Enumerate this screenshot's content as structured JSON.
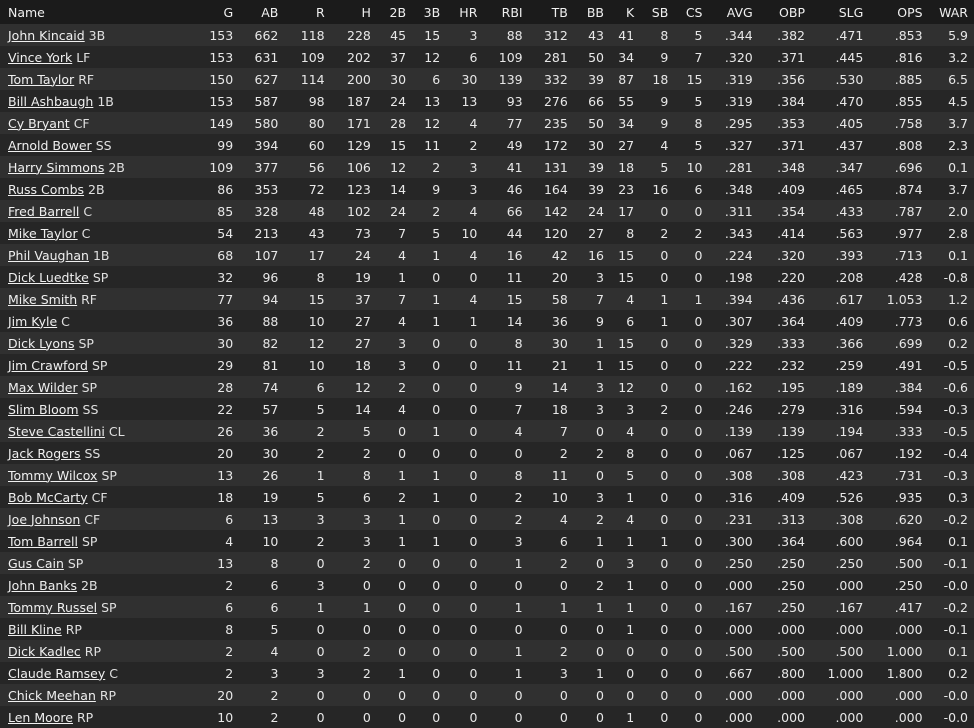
{
  "columns": [
    "Name",
    "G",
    "AB",
    "R",
    "H",
    "2B",
    "3B",
    "HR",
    "RBI",
    "TB",
    "BB",
    "K",
    "SB",
    "CS",
    "AVG",
    "OBP",
    "SLG",
    "OPS",
    "WAR"
  ],
  "rows": [
    {
      "name": "John Kincaid",
      "pos": "3B",
      "stats": [
        "153",
        "662",
        "118",
        "228",
        "45",
        "15",
        "3",
        "88",
        "312",
        "43",
        "41",
        "8",
        "5",
        ".344",
        ".382",
        ".471",
        ".853",
        "5.9"
      ]
    },
    {
      "name": "Vince York",
      "pos": "LF",
      "stats": [
        "153",
        "631",
        "109",
        "202",
        "37",
        "12",
        "6",
        "109",
        "281",
        "50",
        "34",
        "9",
        "7",
        ".320",
        ".371",
        ".445",
        ".816",
        "3.2"
      ]
    },
    {
      "name": "Tom Taylor",
      "pos": "RF",
      "stats": [
        "150",
        "627",
        "114",
        "200",
        "30",
        "6",
        "30",
        "139",
        "332",
        "39",
        "87",
        "18",
        "15",
        ".319",
        ".356",
        ".530",
        ".885",
        "6.5"
      ]
    },
    {
      "name": "Bill Ashbaugh",
      "pos": "1B",
      "stats": [
        "153",
        "587",
        "98",
        "187",
        "24",
        "13",
        "13",
        "93",
        "276",
        "66",
        "55",
        "9",
        "5",
        ".319",
        ".384",
        ".470",
        ".855",
        "4.5"
      ]
    },
    {
      "name": "Cy Bryant",
      "pos": "CF",
      "stats": [
        "149",
        "580",
        "80",
        "171",
        "28",
        "12",
        "4",
        "77",
        "235",
        "50",
        "34",
        "9",
        "8",
        ".295",
        ".353",
        ".405",
        ".758",
        "3.7"
      ]
    },
    {
      "name": "Arnold Bower",
      "pos": "SS",
      "stats": [
        "99",
        "394",
        "60",
        "129",
        "15",
        "11",
        "2",
        "49",
        "172",
        "30",
        "27",
        "4",
        "5",
        ".327",
        ".371",
        ".437",
        ".808",
        "2.3"
      ]
    },
    {
      "name": "Harry Simmons",
      "pos": "2B",
      "stats": [
        "109",
        "377",
        "56",
        "106",
        "12",
        "2",
        "3",
        "41",
        "131",
        "39",
        "18",
        "5",
        "10",
        ".281",
        ".348",
        ".347",
        ".696",
        "0.1"
      ]
    },
    {
      "name": "Russ Combs",
      "pos": "2B",
      "stats": [
        "86",
        "353",
        "72",
        "123",
        "14",
        "9",
        "3",
        "46",
        "164",
        "39",
        "23",
        "16",
        "6",
        ".348",
        ".409",
        ".465",
        ".874",
        "3.7"
      ]
    },
    {
      "name": "Fred Barrell",
      "pos": "C",
      "stats": [
        "85",
        "328",
        "48",
        "102",
        "24",
        "2",
        "4",
        "66",
        "142",
        "24",
        "17",
        "0",
        "0",
        ".311",
        ".354",
        ".433",
        ".787",
        "2.0"
      ]
    },
    {
      "name": "Mike Taylor",
      "pos": "C",
      "stats": [
        "54",
        "213",
        "43",
        "73",
        "7",
        "5",
        "10",
        "44",
        "120",
        "27",
        "8",
        "2",
        "2",
        ".343",
        ".414",
        ".563",
        ".977",
        "2.8"
      ]
    },
    {
      "name": "Phil Vaughan",
      "pos": "1B",
      "stats": [
        "68",
        "107",
        "17",
        "24",
        "4",
        "1",
        "4",
        "16",
        "42",
        "16",
        "15",
        "0",
        "0",
        ".224",
        ".320",
        ".393",
        ".713",
        "0.1"
      ]
    },
    {
      "name": "Dick Luedtke",
      "pos": "SP",
      "stats": [
        "32",
        "96",
        "8",
        "19",
        "1",
        "0",
        "0",
        "11",
        "20",
        "3",
        "15",
        "0",
        "0",
        ".198",
        ".220",
        ".208",
        ".428",
        "-0.8"
      ]
    },
    {
      "name": "Mike Smith",
      "pos": "RF",
      "stats": [
        "77",
        "94",
        "15",
        "37",
        "7",
        "1",
        "4",
        "15",
        "58",
        "7",
        "4",
        "1",
        "1",
        ".394",
        ".436",
        ".617",
        "1.053",
        "1.2"
      ]
    },
    {
      "name": "Jim Kyle",
      "pos": "C",
      "stats": [
        "36",
        "88",
        "10",
        "27",
        "4",
        "1",
        "1",
        "14",
        "36",
        "9",
        "6",
        "1",
        "0",
        ".307",
        ".364",
        ".409",
        ".773",
        "0.6"
      ]
    },
    {
      "name": "Dick Lyons",
      "pos": "SP",
      "stats": [
        "30",
        "82",
        "12",
        "27",
        "3",
        "0",
        "0",
        "8",
        "30",
        "1",
        "15",
        "0",
        "0",
        ".329",
        ".333",
        ".366",
        ".699",
        "0.2"
      ]
    },
    {
      "name": "Jim Crawford",
      "pos": "SP",
      "stats": [
        "29",
        "81",
        "10",
        "18",
        "3",
        "0",
        "0",
        "11",
        "21",
        "1",
        "15",
        "0",
        "0",
        ".222",
        ".232",
        ".259",
        ".491",
        "-0.5"
      ]
    },
    {
      "name": "Max Wilder",
      "pos": "SP",
      "stats": [
        "28",
        "74",
        "6",
        "12",
        "2",
        "0",
        "0",
        "9",
        "14",
        "3",
        "12",
        "0",
        "0",
        ".162",
        ".195",
        ".189",
        ".384",
        "-0.6"
      ]
    },
    {
      "name": "Slim Bloom",
      "pos": "SS",
      "stats": [
        "22",
        "57",
        "5",
        "14",
        "4",
        "0",
        "0",
        "7",
        "18",
        "3",
        "3",
        "2",
        "0",
        ".246",
        ".279",
        ".316",
        ".594",
        "-0.3"
      ]
    },
    {
      "name": "Steve Castellini",
      "pos": "CL",
      "stats": [
        "26",
        "36",
        "2",
        "5",
        "0",
        "1",
        "0",
        "4",
        "7",
        "0",
        "4",
        "0",
        "0",
        ".139",
        ".139",
        ".194",
        ".333",
        "-0.5"
      ]
    },
    {
      "name": "Jack Rogers",
      "pos": "SS",
      "stats": [
        "20",
        "30",
        "2",
        "2",
        "0",
        "0",
        "0",
        "0",
        "2",
        "2",
        "8",
        "0",
        "0",
        ".067",
        ".125",
        ".067",
        ".192",
        "-0.4"
      ]
    },
    {
      "name": "Tommy Wilcox",
      "pos": "SP",
      "stats": [
        "13",
        "26",
        "1",
        "8",
        "1",
        "1",
        "0",
        "8",
        "11",
        "0",
        "5",
        "0",
        "0",
        ".308",
        ".308",
        ".423",
        ".731",
        "-0.3"
      ]
    },
    {
      "name": "Bob McCarty",
      "pos": "CF",
      "stats": [
        "18",
        "19",
        "5",
        "6",
        "2",
        "1",
        "0",
        "2",
        "10",
        "3",
        "1",
        "0",
        "0",
        ".316",
        ".409",
        ".526",
        ".935",
        "0.3"
      ]
    },
    {
      "name": "Joe Johnson",
      "pos": "CF",
      "stats": [
        "6",
        "13",
        "3",
        "3",
        "1",
        "0",
        "0",
        "2",
        "4",
        "2",
        "4",
        "0",
        "0",
        ".231",
        ".313",
        ".308",
        ".620",
        "-0.2"
      ]
    },
    {
      "name": "Tom Barrell",
      "pos": "SP",
      "stats": [
        "4",
        "10",
        "2",
        "3",
        "1",
        "1",
        "0",
        "3",
        "6",
        "1",
        "1",
        "1",
        "0",
        ".300",
        ".364",
        ".600",
        ".964",
        "0.1"
      ]
    },
    {
      "name": "Gus Cain",
      "pos": "SP",
      "stats": [
        "13",
        "8",
        "0",
        "2",
        "0",
        "0",
        "0",
        "1",
        "2",
        "0",
        "3",
        "0",
        "0",
        ".250",
        ".250",
        ".250",
        ".500",
        "-0.1"
      ]
    },
    {
      "name": "John Banks",
      "pos": "2B",
      "stats": [
        "2",
        "6",
        "3",
        "0",
        "0",
        "0",
        "0",
        "0",
        "0",
        "2",
        "1",
        "0",
        "0",
        ".000",
        ".250",
        ".000",
        ".250",
        "-0.0"
      ]
    },
    {
      "name": "Tommy Russel",
      "pos": "SP",
      "stats": [
        "6",
        "6",
        "1",
        "1",
        "0",
        "0",
        "0",
        "1",
        "1",
        "1",
        "1",
        "0",
        "0",
        ".167",
        ".250",
        ".167",
        ".417",
        "-0.2"
      ]
    },
    {
      "name": "Bill Kline",
      "pos": "RP",
      "stats": [
        "8",
        "5",
        "0",
        "0",
        "0",
        "0",
        "0",
        "0",
        "0",
        "0",
        "1",
        "0",
        "0",
        ".000",
        ".000",
        ".000",
        ".000",
        "-0.1"
      ]
    },
    {
      "name": "Dick Kadlec",
      "pos": "RP",
      "stats": [
        "2",
        "4",
        "0",
        "2",
        "0",
        "0",
        "0",
        "1",
        "2",
        "0",
        "0",
        "0",
        "0",
        ".500",
        ".500",
        ".500",
        "1.000",
        "0.1"
      ]
    },
    {
      "name": "Claude Ramsey",
      "pos": "C",
      "stats": [
        "2",
        "3",
        "3",
        "2",
        "1",
        "0",
        "0",
        "1",
        "3",
        "1",
        "0",
        "0",
        "0",
        ".667",
        ".800",
        "1.000",
        "1.800",
        "0.2"
      ]
    },
    {
      "name": "Chick Meehan",
      "pos": "RP",
      "stats": [
        "20",
        "2",
        "0",
        "0",
        "0",
        "0",
        "0",
        "0",
        "0",
        "0",
        "0",
        "0",
        "0",
        ".000",
        ".000",
        ".000",
        ".000",
        "-0.0"
      ]
    },
    {
      "name": "Len Moore",
      "pos": "RP",
      "stats": [
        "10",
        "2",
        "0",
        "0",
        "0",
        "0",
        "0",
        "0",
        "0",
        "0",
        "1",
        "0",
        "0",
        ".000",
        ".000",
        ".000",
        ".000",
        "-0.0"
      ]
    }
  ]
}
